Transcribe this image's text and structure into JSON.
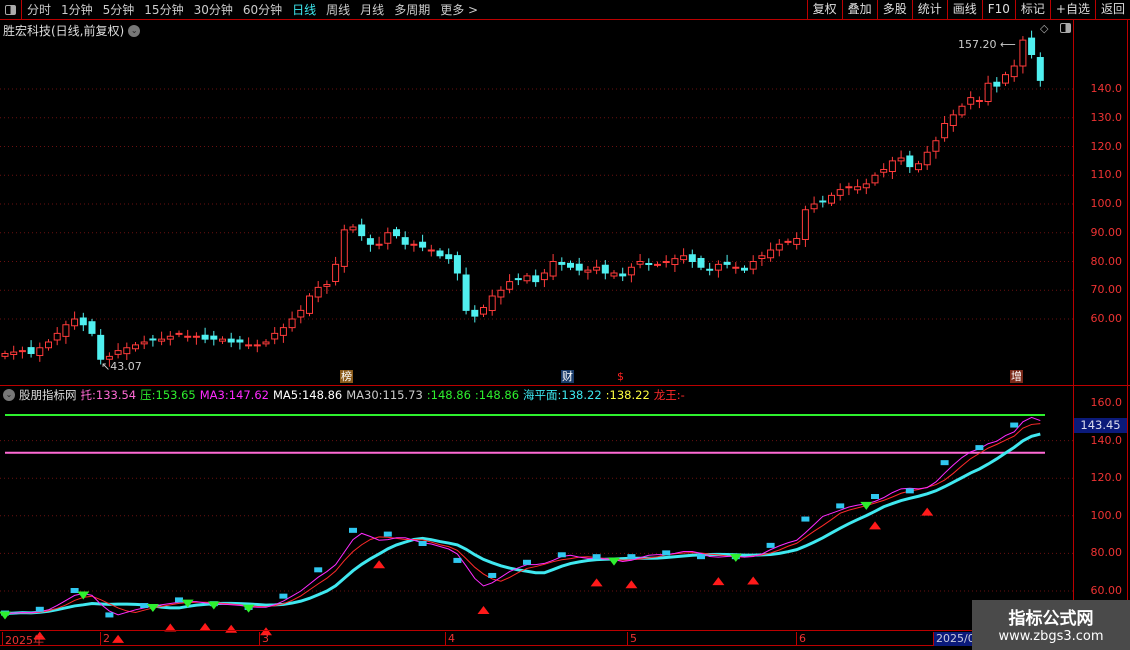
{
  "toolbar": {
    "periods": [
      "分时",
      "1分钟",
      "5分钟",
      "15分钟",
      "30分钟",
      "60分钟",
      "日线",
      "周线",
      "月线",
      "多周期",
      "更多 >"
    ],
    "active": "日线",
    "right_buttons": [
      "复权",
      "叠加",
      "多股",
      "统计",
      "画线",
      "F10",
      "标记",
      "+自选",
      "返回"
    ]
  },
  "stock_title": "胜宏科技(日线,前复权)",
  "price_axis": [
    "140.0",
    "130.0",
    "120.0",
    "110.0",
    "100.0",
    "90.00",
    "80.00",
    "70.00",
    "60.00"
  ],
  "indicator_axis": [
    "160.0",
    "140.0",
    "120.0",
    "100.0",
    "80.00",
    "60.00"
  ],
  "current_value": "143.45",
  "annotations": {
    "high": "157.20",
    "low": "43.07"
  },
  "event_marks": [
    {
      "text": "榜",
      "bg": "#8a5a1a",
      "fg": "#fff"
    },
    {
      "text": "财",
      "bg": "#1a3c6a",
      "fg": "#fff"
    },
    {
      "text": "$",
      "bg": "transparent",
      "fg": "#f22"
    },
    {
      "text": "增",
      "bg": "#7a2a1a",
      "fg": "#fff"
    }
  ],
  "indicator": {
    "name": "股朋指标网",
    "items": [
      {
        "label": "托:",
        "value": "133.54",
        "color": "#ff6ad5"
      },
      {
        "label": "压:",
        "value": "153.65",
        "color": "#2ef02e"
      },
      {
        "label": "MA3:",
        "value": "147.62",
        "color": "#ff2aff"
      },
      {
        "label": "MA5:",
        "value": "148.86",
        "color": "#ffffff"
      },
      {
        "label": "MA30:",
        "value": "115.73",
        "color": "#cccccc"
      },
      {
        "label": ":",
        "value": "148.86",
        "color": "#2ef02e"
      },
      {
        "label": ":",
        "value": "148.86",
        "color": "#2ef02e"
      },
      {
        "label": "海平面:",
        "value": "138.22",
        "color": "#3ee8f0"
      },
      {
        "label": ":",
        "value": "138.22",
        "color": "#ffff40"
      },
      {
        "label": "龙王:",
        "value": "-",
        "color": "#ff2a2a"
      }
    ]
  },
  "time_axis": [
    "2025年",
    "2",
    "3",
    "4",
    "5",
    "6",
    "2025/0"
  ],
  "watermark": {
    "title": "指标公式网",
    "url": "www.zbgs3.com"
  },
  "colors": {
    "up": "#ff3b3b",
    "down": "#50f0f0",
    "support": "#ff6ad5",
    "resist": "#2ef02e"
  },
  "chart_data": {
    "type": "candlestick",
    "close": [
      48,
      48.5,
      49,
      48,
      50,
      52,
      55,
      58,
      60,
      58,
      55,
      46,
      47,
      49,
      50,
      51,
      52,
      53,
      53,
      54,
      55,
      54,
      54,
      53,
      53,
      53,
      52,
      52,
      51,
      51,
      52,
      55,
      57,
      60,
      63,
      68,
      71,
      72,
      79,
      91,
      92,
      89,
      86,
      86,
      90,
      89,
      86,
      86,
      85,
      84,
      82,
      81,
      76,
      63,
      61,
      64,
      68,
      70,
      73,
      74,
      75,
      73,
      76,
      80,
      79,
      78,
      77,
      77,
      78,
      76,
      76,
      75,
      78,
      80,
      79,
      79,
      80,
      81,
      82,
      80,
      78,
      77,
      79,
      79,
      78,
      77,
      80,
      82,
      84,
      86,
      87,
      88,
      98,
      100,
      101,
      103,
      105,
      106,
      106,
      107,
      110,
      112,
      115,
      116,
      113,
      114,
      118,
      122,
      128,
      131,
      134,
      137,
      136,
      142,
      141,
      145,
      148,
      157,
      152,
      143
    ],
    "support": 133.54,
    "resistance": 153.65,
    "buy_signals": [
      4,
      13,
      19,
      23,
      26,
      30,
      43,
      55,
      68,
      72,
      82,
      86,
      100,
      106
    ],
    "sell_signals": [
      0,
      9,
      17,
      21,
      24,
      28,
      70,
      84,
      99
    ]
  }
}
